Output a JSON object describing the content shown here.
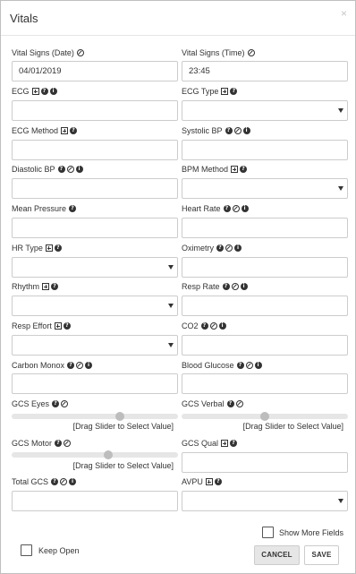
{
  "dialog": {
    "title": "Vitals",
    "close_glyph": "×"
  },
  "fields": {
    "vs_date": {
      "label": "Vital Signs (Date)",
      "value": "04/01/2019",
      "icons": [
        "ban-icon"
      ]
    },
    "vs_time": {
      "label": "Vital Signs (Time)",
      "value": "23:45",
      "icons": [
        "ban-icon"
      ]
    },
    "ecg": {
      "label": "ECG",
      "value": "",
      "icons": [
        "plus-box-icon",
        "question-icon",
        "info-icon"
      ]
    },
    "ecg_type": {
      "label": "ECG Type",
      "value": "",
      "icons": [
        "plus-box-icon",
        "question-icon"
      ]
    },
    "ecg_method": {
      "label": "ECG Method",
      "value": "",
      "icons": [
        "plus-box-icon",
        "question-icon"
      ]
    },
    "systolic": {
      "label": "Systolic BP",
      "value": "",
      "icons": [
        "question-icon",
        "ban-icon",
        "info-icon"
      ]
    },
    "diastolic": {
      "label": "Diastolic BP",
      "value": "",
      "icons": [
        "question-icon",
        "ban-icon",
        "info-icon"
      ]
    },
    "bpm_method": {
      "label": "BPM Method",
      "value": "",
      "icons": [
        "plus-box-icon",
        "question-icon"
      ]
    },
    "mean_pressure": {
      "label": "Mean Pressure",
      "value": "",
      "icons": [
        "question-icon"
      ]
    },
    "heart_rate": {
      "label": "Heart Rate",
      "value": "",
      "icons": [
        "question-icon",
        "ban-icon",
        "info-icon"
      ]
    },
    "hr_type": {
      "label": "HR Type",
      "value": "",
      "icons": [
        "plus-box-icon",
        "question-icon"
      ]
    },
    "oximetry": {
      "label": "Oximetry",
      "value": "",
      "icons": [
        "question-icon",
        "ban-icon",
        "info-icon"
      ]
    },
    "rhythm": {
      "label": "Rhythm",
      "value": "",
      "icons": [
        "plus-box-icon",
        "question-icon"
      ]
    },
    "resp_rate": {
      "label": "Resp Rate",
      "value": "",
      "icons": [
        "question-icon",
        "ban-icon",
        "info-icon"
      ]
    },
    "resp_effort": {
      "label": "Resp Effort",
      "value": "",
      "icons": [
        "plus-box-icon",
        "question-icon"
      ]
    },
    "co2": {
      "label": "CO2",
      "value": "",
      "icons": [
        "question-icon",
        "ban-icon",
        "info-icon"
      ]
    },
    "carbon_monox": {
      "label": "Carbon Monox",
      "value": "",
      "icons": [
        "question-icon",
        "ban-icon",
        "info-icon"
      ]
    },
    "blood_glucose": {
      "label": "Blood Glucose",
      "value": "",
      "icons": [
        "question-icon",
        "ban-icon",
        "info-icon"
      ]
    },
    "gcs_eyes": {
      "label": "GCS Eyes",
      "icons": [
        "question-icon",
        "ban-icon"
      ],
      "hint": "[Drag Slider to Select Value]",
      "level": 0.65
    },
    "gcs_verbal": {
      "label": "GCS Verbal",
      "icons": [
        "question-icon",
        "ban-icon"
      ],
      "hint": "[Drag Slider to Select Value]",
      "level": 0.5
    },
    "gcs_motor": {
      "label": "GCS Motor",
      "icons": [
        "question-icon",
        "ban-icon"
      ],
      "hint": "[Drag Slider to Select Value]",
      "level": 0.58
    },
    "gcs_qual": {
      "label": "GCS Qual",
      "value": "",
      "icons": [
        "plus-box-icon",
        "question-icon"
      ]
    },
    "total_gcs": {
      "label": "Total GCS",
      "value": "",
      "icons": [
        "question-icon",
        "ban-icon",
        "info-icon"
      ]
    },
    "avpu": {
      "label": "AVPU",
      "value": "",
      "icons": [
        "plus-box-icon",
        "question-icon"
      ]
    }
  },
  "footer": {
    "show_more_label": "Show More Fields",
    "keep_open_label": "Keep Open",
    "cancel_label": "CANCEL",
    "save_label": "SAVE"
  },
  "icon_glyphs": {
    "question-icon": "?",
    "info-icon": "i"
  }
}
